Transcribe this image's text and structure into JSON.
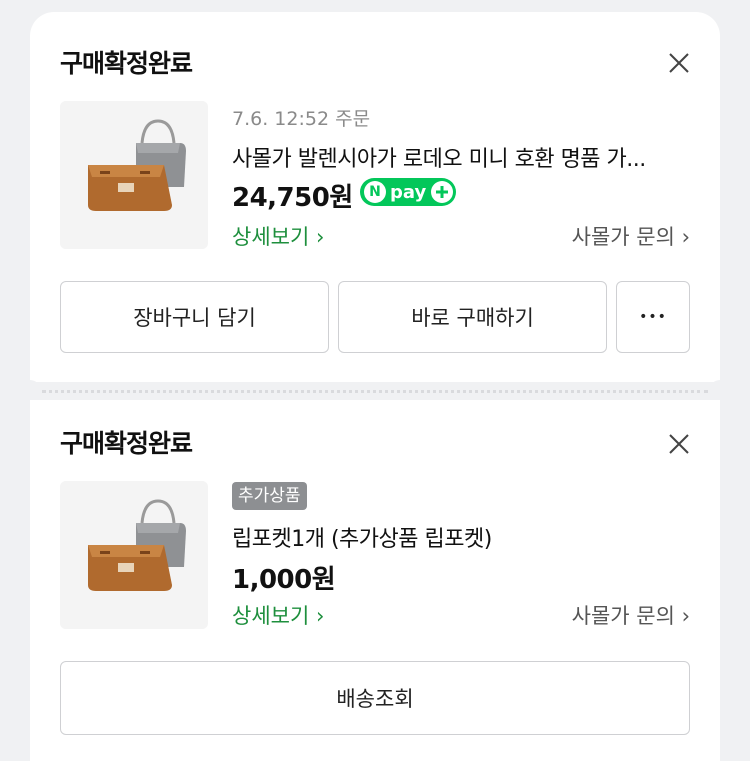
{
  "orders": [
    {
      "status": "구매확정완료",
      "order_time": "7.6. 12:52 주문",
      "product_name": "사몰가 발렌시아가 로데오 미니 호환 명품 가...",
      "price": "24,750원",
      "npay_label": "pay",
      "npay_n": "N",
      "detail_link": "상세보기 ›",
      "inquiry_link": "사몰가 문의 ›",
      "buttons": {
        "cart": "장바구니 담기",
        "buy_now": "바로 구매하기",
        "more": "•••"
      }
    },
    {
      "status": "구매확정완료",
      "badge": "추가상품",
      "product_name": "립포켓1개 (추가상품 립포켓)",
      "price": "1,000원",
      "detail_link": "상세보기 ›",
      "inquiry_link": "사몰가 문의 ›",
      "buttons": {
        "track": "배송조회"
      }
    }
  ],
  "colors": {
    "npay": "#03c75a",
    "link_green": "#1e8f3d",
    "badge_gray": "#8d8f92",
    "background": "#f0f1f3"
  },
  "icons": [
    "close-icon",
    "npay-logo",
    "plus-icon",
    "more-icon",
    "product-thumbnail"
  ]
}
